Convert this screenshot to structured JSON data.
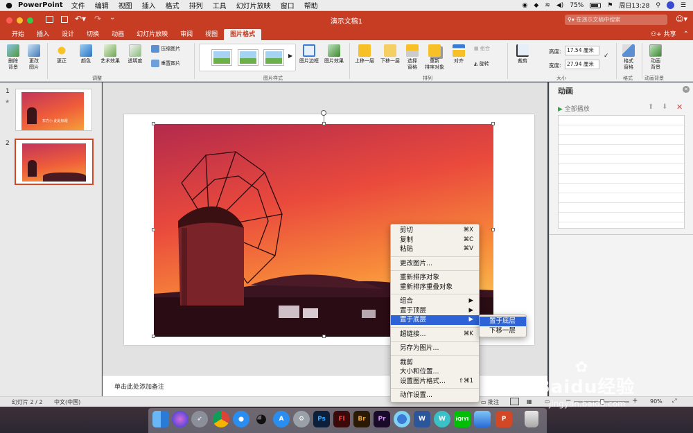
{
  "menubar": {
    "app": "PowerPoint",
    "items": [
      "文件",
      "编辑",
      "视图",
      "插入",
      "格式",
      "排列",
      "工具",
      "幻灯片放映",
      "窗口",
      "帮助"
    ],
    "battery": "75%",
    "clock": "周日13:28"
  },
  "window": {
    "title": "演示文稿1",
    "search_placeholder": "在演示文稿中搜索",
    "share_label": "共享"
  },
  "tabs": [
    {
      "label": "开始"
    },
    {
      "label": "插入"
    },
    {
      "label": "设计"
    },
    {
      "label": "切换"
    },
    {
      "label": "动画"
    },
    {
      "label": "幻灯片放映"
    },
    {
      "label": "审阅"
    },
    {
      "label": "视图"
    },
    {
      "label": "图片格式"
    }
  ],
  "ribbon": {
    "remove_bg": "删除\n背景",
    "change_pic": "更改\n图片",
    "corrections": "更正",
    "color": "颜色",
    "artistic": "艺术效果",
    "transparency": "透明度",
    "compress": "压缩图片",
    "reset": "重置图片",
    "group_adjust": "调整",
    "border": "图片边框",
    "effects": "图片效果",
    "group_styles": "图片样式",
    "bring_forward": "上移一层",
    "send_backward": "下移一层",
    "selection_pane": "选择\n窗格",
    "reorder": "重新\n排序对象",
    "align": "对齐",
    "group": "组合",
    "rotate": "旋转",
    "group_arrange": "排列",
    "crop": "裁剪",
    "height_label": "高度:",
    "height_value": "17.54 厘米",
    "width_label": "宽度:",
    "width_value": "27.94 厘米",
    "group_size": "大小",
    "format_pane": "格式\n窗格",
    "group_format": "格式",
    "anim_bg": "动画\n背景",
    "group_anim_bg": "动画背景"
  },
  "thumbs": [
    {
      "num": "1",
      "star": "★",
      "caption": "东方小 此处标题"
    },
    {
      "num": "2"
    }
  ],
  "notes_placeholder": "单击此处添加备注",
  "anim_pane": {
    "title": "动画",
    "play_all": "全部播放"
  },
  "context_menu": {
    "items": [
      {
        "label": "剪切",
        "shortcut": "⌘X"
      },
      {
        "label": "复制",
        "shortcut": "⌘C"
      },
      {
        "label": "粘贴",
        "shortcut": "⌘V"
      },
      {
        "label": "更改图片..."
      },
      {
        "label": "重新排序对象"
      },
      {
        "label": "重新排序重叠对象"
      },
      {
        "label": "组合",
        "submenu": "▶"
      },
      {
        "label": "置于顶层",
        "submenu": "▶"
      },
      {
        "label": "置于底层",
        "submenu": "▶"
      },
      {
        "label": "超链接...",
        "shortcut": "⌘K"
      },
      {
        "label": "另存为图片..."
      },
      {
        "label": "裁剪"
      },
      {
        "label": "大小和位置..."
      },
      {
        "label": "设置图片格式...",
        "shortcut": "⇧⌘1"
      },
      {
        "label": "动作设置..."
      }
    ]
  },
  "submenu": {
    "items": [
      {
        "label": "置于底层"
      },
      {
        "label": "下移一层"
      }
    ]
  },
  "status": {
    "slide": "幻灯片 2 / 2",
    "language": "中文(中国)",
    "comments": "批注",
    "zoom": "90%"
  },
  "dock": {
    "ps": "Ps",
    "fl": "Fl",
    "br": "Br",
    "pr": "Pr",
    "w": "W",
    "iqiyi": "iQIYI",
    "ppt": "P"
  },
  "watermark": {
    "brand": "Baidu经验",
    "url": "jingyan.baidu.com"
  },
  "colors": {
    "accent": "#c63d23",
    "menu_highlight": "#2d63d6"
  }
}
